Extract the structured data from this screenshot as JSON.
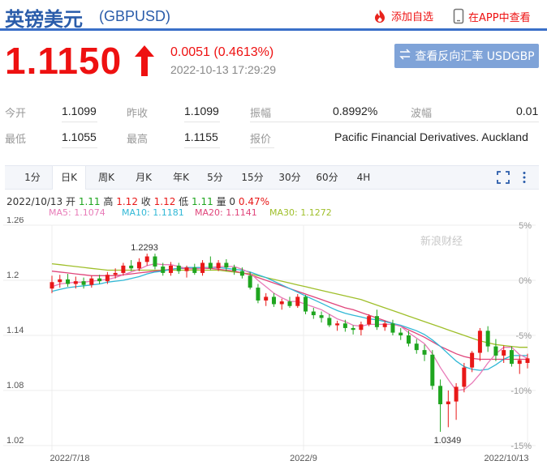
{
  "header": {
    "title": "英镑美元",
    "code": "(GBPUSD)",
    "add_label": "添加自选",
    "app_label": "在APP中查看"
  },
  "quote": {
    "price": "1.1150",
    "change": "0.0051 (0.4613%)",
    "time": "2022-10-13 17:29:29",
    "reverse_button": "查看反向汇率 USDGBP"
  },
  "stats": {
    "open_label": "今开",
    "open": "1.1099",
    "prev_close_label": "昨收",
    "prev_close": "1.1099",
    "amplitude_label": "振幅",
    "amplitude": "0.8992%",
    "wave_label": "波幅",
    "wave": "0.01",
    "low_label": "最低",
    "low": "1.1055",
    "high_label": "最高",
    "high": "1.1155",
    "quote_label": "报价",
    "quote_source": "Pacific Financial Derivatives. Auckland"
  },
  "tabs": [
    "1分",
    "日K",
    "周K",
    "月K",
    "年K",
    "5分",
    "15分",
    "30分",
    "60分",
    "4H"
  ],
  "candle_info": {
    "date": "2022/10/13",
    "open_label": "开",
    "open": "1.11",
    "high_label": "高",
    "high": "1.12",
    "close_label": "收",
    "close": "1.12",
    "low_label": "低",
    "low": "1.11",
    "vol_label": "量",
    "vol": "0",
    "pct": "0.47%"
  },
  "ma": {
    "ma5": "MA5: 1.1074",
    "ma10": "MA10: 1.1181",
    "ma20": "MA20: 1.1141",
    "ma30": "MA30: 1.1272"
  },
  "watermark": "新浪财经",
  "colors": {
    "up": "#e81818",
    "down": "#1fa51f",
    "ma5": "#e87bb8",
    "ma10": "#30b8d6",
    "ma20": "#e0457b",
    "ma30": "#9fbf2a",
    "brand": "#2a5caa"
  },
  "chart_data": {
    "type": "candlestick",
    "y_ticks": [
      "1.26",
      "1.2",
      "1.14",
      "1.08",
      "1.02"
    ],
    "pct_ticks": [
      "5%",
      "0%",
      "-5%",
      "-10%",
      "-15%"
    ],
    "ylim": [
      1.02,
      1.26
    ],
    "x_ticks": [
      "2022/7/18",
      "2022/9",
      "2022/10/13"
    ],
    "annotations": [
      {
        "label": "1.2293",
        "date": "2022/8/1",
        "value": 1.2293
      },
      {
        "label": "1.0349",
        "date": "2022/9/26",
        "value": 1.0349
      }
    ],
    "candles": [
      {
        "o": 1.191,
        "h": 1.205,
        "l": 1.186,
        "c": 1.198
      },
      {
        "o": 1.198,
        "h": 1.206,
        "l": 1.192,
        "c": 1.201
      },
      {
        "o": 1.201,
        "h": 1.207,
        "l": 1.193,
        "c": 1.196
      },
      {
        "o": 1.196,
        "h": 1.204,
        "l": 1.191,
        "c": 1.199
      },
      {
        "o": 1.199,
        "h": 1.203,
        "l": 1.191,
        "c": 1.195
      },
      {
        "o": 1.195,
        "h": 1.205,
        "l": 1.192,
        "c": 1.202
      },
      {
        "o": 1.202,
        "h": 1.206,
        "l": 1.196,
        "c": 1.199
      },
      {
        "o": 1.199,
        "h": 1.209,
        "l": 1.196,
        "c": 1.206
      },
      {
        "o": 1.206,
        "h": 1.213,
        "l": 1.202,
        "c": 1.208
      },
      {
        "o": 1.208,
        "h": 1.219,
        "l": 1.205,
        "c": 1.216
      },
      {
        "o": 1.216,
        "h": 1.222,
        "l": 1.21,
        "c": 1.213
      },
      {
        "o": 1.213,
        "h": 1.224,
        "l": 1.21,
        "c": 1.22
      },
      {
        "o": 1.22,
        "h": 1.229,
        "l": 1.216,
        "c": 1.226
      },
      {
        "o": 1.226,
        "h": 1.229,
        "l": 1.212,
        "c": 1.215
      },
      {
        "o": 1.215,
        "h": 1.219,
        "l": 1.205,
        "c": 1.208
      },
      {
        "o": 1.208,
        "h": 1.22,
        "l": 1.205,
        "c": 1.216
      },
      {
        "o": 1.216,
        "h": 1.219,
        "l": 1.207,
        "c": 1.21
      },
      {
        "o": 1.21,
        "h": 1.216,
        "l": 1.203,
        "c": 1.214
      },
      {
        "o": 1.214,
        "h": 1.218,
        "l": 1.206,
        "c": 1.208
      },
      {
        "o": 1.208,
        "h": 1.222,
        "l": 1.205,
        "c": 1.219
      },
      {
        "o": 1.219,
        "h": 1.226,
        "l": 1.211,
        "c": 1.213
      },
      {
        "o": 1.213,
        "h": 1.222,
        "l": 1.21,
        "c": 1.219
      },
      {
        "o": 1.219,
        "h": 1.223,
        "l": 1.21,
        "c": 1.214
      },
      {
        "o": 1.214,
        "h": 1.217,
        "l": 1.206,
        "c": 1.21
      },
      {
        "o": 1.21,
        "h": 1.214,
        "l": 1.202,
        "c": 1.205
      },
      {
        "o": 1.205,
        "h": 1.209,
        "l": 1.19,
        "c": 1.192
      },
      {
        "o": 1.192,
        "h": 1.196,
        "l": 1.175,
        "c": 1.178
      },
      {
        "o": 1.178,
        "h": 1.186,
        "l": 1.172,
        "c": 1.182
      },
      {
        "o": 1.182,
        "h": 1.186,
        "l": 1.171,
        "c": 1.174
      },
      {
        "o": 1.174,
        "h": 1.18,
        "l": 1.168,
        "c": 1.177
      },
      {
        "o": 1.177,
        "h": 1.182,
        "l": 1.17,
        "c": 1.172
      },
      {
        "o": 1.172,
        "h": 1.185,
        "l": 1.17,
        "c": 1.182
      },
      {
        "o": 1.182,
        "h": 1.184,
        "l": 1.163,
        "c": 1.166
      },
      {
        "o": 1.166,
        "h": 1.17,
        "l": 1.158,
        "c": 1.162
      },
      {
        "o": 1.162,
        "h": 1.166,
        "l": 1.154,
        "c": 1.159
      },
      {
        "o": 1.159,
        "h": 1.163,
        "l": 1.149,
        "c": 1.151
      },
      {
        "o": 1.151,
        "h": 1.156,
        "l": 1.145,
        "c": 1.153
      },
      {
        "o": 1.153,
        "h": 1.157,
        "l": 1.144,
        "c": 1.148
      },
      {
        "o": 1.148,
        "h": 1.151,
        "l": 1.141,
        "c": 1.146
      },
      {
        "o": 1.146,
        "h": 1.155,
        "l": 1.14,
        "c": 1.152
      },
      {
        "o": 1.152,
        "h": 1.163,
        "l": 1.15,
        "c": 1.161
      },
      {
        "o": 1.161,
        "h": 1.168,
        "l": 1.146,
        "c": 1.149
      },
      {
        "o": 1.149,
        "h": 1.156,
        "l": 1.145,
        "c": 1.153
      },
      {
        "o": 1.153,
        "h": 1.157,
        "l": 1.14,
        "c": 1.143
      },
      {
        "o": 1.143,
        "h": 1.148,
        "l": 1.135,
        "c": 1.14
      },
      {
        "o": 1.14,
        "h": 1.145,
        "l": 1.128,
        "c": 1.131
      },
      {
        "o": 1.131,
        "h": 1.136,
        "l": 1.12,
        "c": 1.124
      },
      {
        "o": 1.124,
        "h": 1.13,
        "l": 1.112,
        "c": 1.119
      },
      {
        "o": 1.119,
        "h": 1.124,
        "l": 1.081,
        "c": 1.085
      },
      {
        "o": 1.085,
        "h": 1.092,
        "l": 1.035,
        "c": 1.065
      },
      {
        "o": 1.065,
        "h": 1.08,
        "l": 1.04,
        "c": 1.068
      },
      {
        "o": 1.068,
        "h": 1.088,
        "l": 1.048,
        "c": 1.084
      },
      {
        "o": 1.084,
        "h": 1.11,
        "l": 1.078,
        "c": 1.105
      },
      {
        "o": 1.105,
        "h": 1.123,
        "l": 1.1,
        "c": 1.121
      },
      {
        "o": 1.121,
        "h": 1.148,
        "l": 1.112,
        "c": 1.145
      },
      {
        "o": 1.145,
        "h": 1.15,
        "l": 1.122,
        "c": 1.128
      },
      {
        "o": 1.128,
        "h": 1.136,
        "l": 1.112,
        "c": 1.118
      },
      {
        "o": 1.118,
        "h": 1.129,
        "l": 1.11,
        "c": 1.124
      },
      {
        "o": 1.124,
        "h": 1.128,
        "l": 1.106,
        "c": 1.109
      },
      {
        "o": 1.109,
        "h": 1.118,
        "l": 1.098,
        "c": 1.113
      },
      {
        "o": 1.11,
        "h": 1.12,
        "l": 1.104,
        "c": 1.115
      }
    ],
    "ma5": [
      1.193,
      1.196,
      1.197,
      1.198,
      1.198,
      1.199,
      1.2,
      1.201,
      1.203,
      1.206,
      1.209,
      1.212,
      1.216,
      1.218,
      1.217,
      1.217,
      1.215,
      1.213,
      1.212,
      1.213,
      1.214,
      1.215,
      1.215,
      1.215,
      1.212,
      1.208,
      1.2,
      1.193,
      1.186,
      1.181,
      1.177,
      1.177,
      1.174,
      1.171,
      1.168,
      1.163,
      1.158,
      1.155,
      1.151,
      1.15,
      1.152,
      1.152,
      1.152,
      1.152,
      1.15,
      1.143,
      1.137,
      1.131,
      1.12,
      1.105,
      1.092,
      1.08,
      1.081,
      1.088,
      1.098,
      1.11,
      1.12,
      1.127,
      1.127,
      1.119,
      1.115
    ],
    "ma10": [
      1.188,
      1.19,
      1.192,
      1.193,
      1.194,
      1.195,
      1.196,
      1.198,
      1.199,
      1.2,
      1.202,
      1.204,
      1.207,
      1.209,
      1.21,
      1.212,
      1.213,
      1.214,
      1.214,
      1.214,
      1.214,
      1.214,
      1.213,
      1.212,
      1.211,
      1.209,
      1.206,
      1.203,
      1.199,
      1.195,
      1.191,
      1.187,
      1.183,
      1.179,
      1.175,
      1.171,
      1.167,
      1.164,
      1.162,
      1.16,
      1.158,
      1.157,
      1.155,
      1.153,
      1.151,
      1.148,
      1.145,
      1.141,
      1.135,
      1.128,
      1.12,
      1.112,
      1.106,
      1.103,
      1.102,
      1.103,
      1.108,
      1.114,
      1.118,
      1.118,
      1.118
    ],
    "ma20": [
      1.21,
      1.209,
      1.208,
      1.207,
      1.206,
      1.205,
      1.205,
      1.205,
      1.205,
      1.206,
      1.207,
      1.208,
      1.209,
      1.21,
      1.211,
      1.212,
      1.213,
      1.213,
      1.213,
      1.213,
      1.213,
      1.212,
      1.211,
      1.21,
      1.208,
      1.206,
      1.203,
      1.2,
      1.197,
      1.194,
      1.191,
      1.188,
      1.185,
      1.182,
      1.179,
      1.176,
      1.173,
      1.17,
      1.168,
      1.165,
      1.162,
      1.159,
      1.156,
      1.153,
      1.15,
      1.146,
      1.142,
      1.138,
      1.133,
      1.128,
      1.124,
      1.12,
      1.117,
      1.115,
      1.114,
      1.114,
      1.114,
      1.114,
      1.114,
      1.114,
      1.114
    ],
    "ma30": [
      1.218,
      1.217,
      1.216,
      1.215,
      1.214,
      1.213,
      1.212,
      1.211,
      1.211,
      1.211,
      1.211,
      1.211,
      1.211,
      1.211,
      1.211,
      1.211,
      1.211,
      1.211,
      1.211,
      1.211,
      1.211,
      1.211,
      1.21,
      1.209,
      1.208,
      1.207,
      1.205,
      1.203,
      1.201,
      1.199,
      1.197,
      1.195,
      1.193,
      1.191,
      1.189,
      1.187,
      1.185,
      1.183,
      1.181,
      1.179,
      1.176,
      1.173,
      1.17,
      1.167,
      1.164,
      1.161,
      1.158,
      1.155,
      1.152,
      1.149,
      1.146,
      1.143,
      1.14,
      1.137,
      1.134,
      1.132,
      1.13,
      1.129,
      1.128,
      1.127,
      1.127
    ]
  }
}
